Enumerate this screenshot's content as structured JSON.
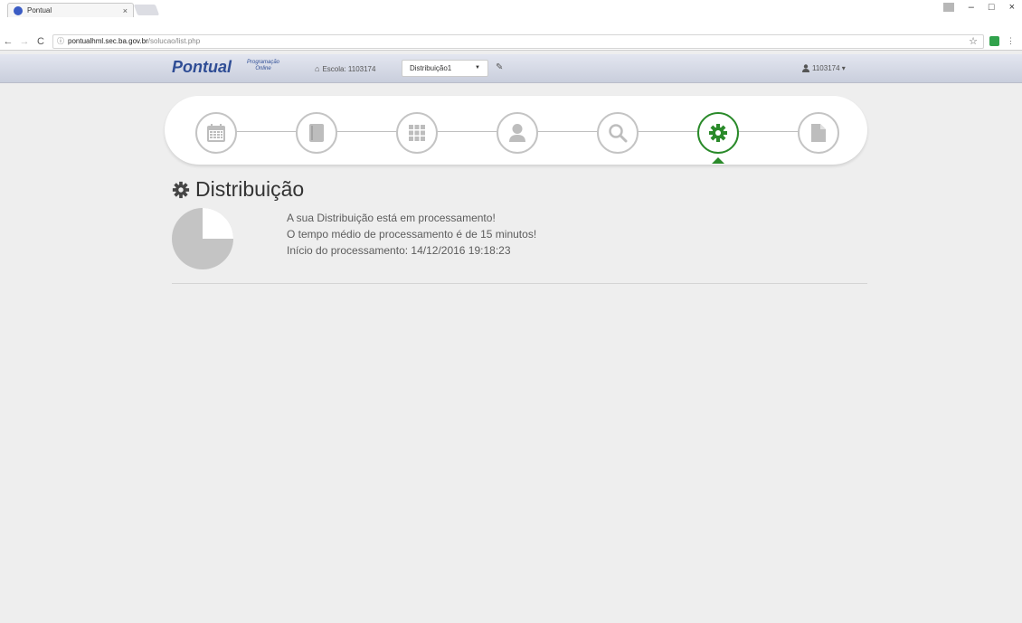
{
  "browser": {
    "tab_title": "Pontual",
    "tab_close": "×",
    "url_host": "pontualhml.sec.ba.gov.br",
    "url_path": "/solucao/list.php",
    "url_info": "ⓘ",
    "nav_back": "←",
    "nav_forward": "→",
    "nav_reload": "C",
    "star": "☆",
    "window_minimize": "–",
    "window_restore": "□",
    "window_close": "×",
    "menu": "⋮"
  },
  "navbar": {
    "brand": "Pontual",
    "brand_sub_1": "Programação",
    "brand_sub_2": "Online",
    "escola_label": "Escola: 1103174",
    "distribution_select": "Distribuição1",
    "user_label": "1103174 ▾"
  },
  "wizard": {
    "steps": [
      "calendar-icon",
      "book-icon",
      "grid-icon",
      "user-icon",
      "search-icon",
      "gear-icon",
      "document-icon"
    ],
    "active_step": 5,
    "active_color": "#2a8a2a"
  },
  "content": {
    "title": "Distribuição",
    "progress_fraction": 0.25,
    "messages": [
      "A sua Distribuição está em processamento!",
      "O tempo médio de processamento é de 15 minutos!",
      "Início do processamento: 14/12/2016 19:18:23"
    ]
  }
}
